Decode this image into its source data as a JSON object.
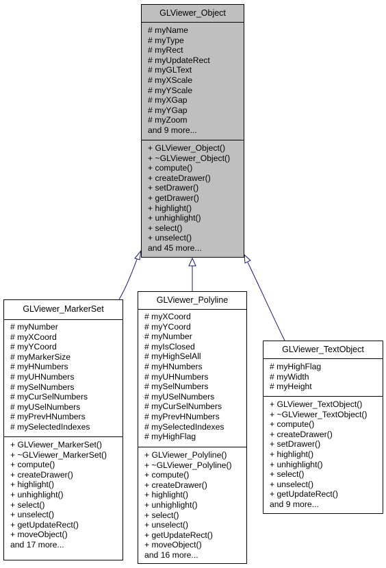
{
  "diagram": {
    "type": "class-inheritance",
    "edge_color": "#191970",
    "base_fill": "#bfbfbf",
    "classes": [
      {
        "id": "base",
        "name": "GLViewer_Object",
        "attributes": [
          "# myName",
          "# myType",
          "# myRect",
          "# myUpdateRect",
          "# myGLText",
          "# myXScale",
          "# myYScale",
          "# myXGap",
          "# myYGap",
          "# myZoom",
          "and 9 more..."
        ],
        "methods": [
          "+ GLViewer_Object()",
          "+ ~GLViewer_Object()",
          "+ compute()",
          "+ createDrawer()",
          "+ setDrawer()",
          "+ getDrawer()",
          "+ highlight()",
          "+ unhighlight()",
          "+ select()",
          "+ unselect()",
          "and 45 more..."
        ]
      },
      {
        "id": "markerset",
        "name": "GLViewer_MarkerSet",
        "attributes": [
          "# myNumber",
          "# myXCoord",
          "# myYCoord",
          "# myMarkerSize",
          "# myHNumbers",
          "# myUHNumbers",
          "# mySelNumbers",
          "# myCurSelNumbers",
          "# myUSelNumbers",
          "# myPrevHNumbers",
          "# mySelectedIndexes"
        ],
        "methods": [
          "+ GLViewer_MarkerSet()",
          "+ ~GLViewer_MarkerSet()",
          "+ compute()",
          "+ createDrawer()",
          "+ highlight()",
          "+ unhighlight()",
          "+ select()",
          "+ unselect()",
          "+ getUpdateRect()",
          "+ moveObject()",
          "and 17 more..."
        ]
      },
      {
        "id": "polyline",
        "name": "GLViewer_Polyline",
        "attributes": [
          "# myXCoord",
          "# myYCoord",
          "# myNumber",
          "# myIsClosed",
          "# myHighSelAll",
          "# myHNumbers",
          "# myUHNumbers",
          "# mySelNumbers",
          "# myUSelNumbers",
          "# myCurSelNumbers",
          "# myPrevHNumbers",
          "# mySelectedIndexes",
          "# myHighFlag"
        ],
        "methods": [
          "+ GLViewer_Polyline()",
          "+ ~GLViewer_Polyline()",
          "+ compute()",
          "+ createDrawer()",
          "+ highlight()",
          "+ unhighlight()",
          "+ select()",
          "+ unselect()",
          "+ getUpdateRect()",
          "+ moveObject()",
          "and 16 more..."
        ]
      },
      {
        "id": "textobject",
        "name": "GLViewer_TextObject",
        "attributes": [
          "# myHighFlag",
          "# myWidth",
          "# myHeight"
        ],
        "methods": [
          "+ GLViewer_TextObject()",
          "+ ~GLViewer_TextObject()",
          "+ compute()",
          "+ createDrawer()",
          "+ setDrawer()",
          "+ highlight()",
          "+ unhighlight()",
          "+ select()",
          "+ unselect()",
          "+ getUpdateRect()",
          "and 9 more..."
        ]
      }
    ],
    "edges": [
      {
        "from": "GLViewer_MarkerSet",
        "to": "GLViewer_Object",
        "kind": "inherits"
      },
      {
        "from": "GLViewer_Polyline",
        "to": "GLViewer_Object",
        "kind": "inherits"
      },
      {
        "from": "GLViewer_TextObject",
        "to": "GLViewer_Object",
        "kind": "inherits"
      }
    ]
  }
}
